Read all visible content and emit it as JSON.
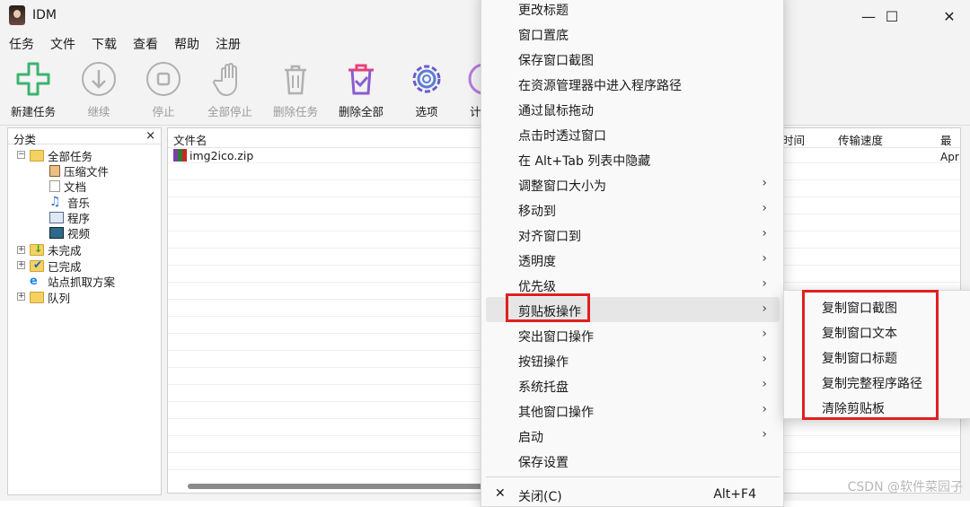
{
  "window": {
    "title": "IDM",
    "minimize": "—",
    "maximize": "☐",
    "close": "✕"
  },
  "menubar": [
    "任务",
    "文件",
    "下载",
    "查看",
    "帮助",
    "注册"
  ],
  "toolbar": [
    {
      "label": "新建任务",
      "icon": "add-task-icon",
      "enabled": true
    },
    {
      "label": "继续",
      "icon": "resume-icon",
      "enabled": false
    },
    {
      "label": "停止",
      "icon": "stop-icon",
      "enabled": false
    },
    {
      "label": "全部停止",
      "icon": "stop-all-icon",
      "enabled": false
    },
    {
      "label": "删除任务",
      "icon": "delete-task-icon",
      "enabled": false
    },
    {
      "label": "删除全部",
      "icon": "delete-all-icon",
      "enabled": true
    },
    {
      "label": "选项",
      "icon": "gear-icon",
      "enabled": true
    },
    {
      "label": "计",
      "icon": "scheduler-icon",
      "enabled": true
    }
  ],
  "sidebar": {
    "title": "分类",
    "close": "×",
    "tree": [
      {
        "label": "全部任务",
        "icon": "folder-icon",
        "expand": "−"
      },
      {
        "label": "压缩文件",
        "icon": "archive-icon"
      },
      {
        "label": "文档",
        "icon": "document-icon"
      },
      {
        "label": "音乐",
        "icon": "music-icon"
      },
      {
        "label": "程序",
        "icon": "program-icon"
      },
      {
        "label": "视频",
        "icon": "video-icon"
      },
      {
        "label": "未完成",
        "icon": "unfinished-folder-icon",
        "expand": "+"
      },
      {
        "label": "已完成",
        "icon": "finished-folder-icon",
        "expand": "+"
      },
      {
        "label": "站点抓取方案",
        "icon": "site-grabber-icon"
      },
      {
        "label": "队列",
        "icon": "queue-folder-icon",
        "expand": "+"
      }
    ]
  },
  "list": {
    "headers": {
      "filename": "文件名",
      "time": "时间",
      "speed": "传输速度",
      "last": "最后"
    },
    "rows": [
      {
        "filename": "img2ico.zip",
        "last": "Apr"
      }
    ]
  },
  "context_menu": {
    "items": [
      {
        "label": "更改标题",
        "submenu": false
      },
      {
        "label": "窗口置底",
        "submenu": false
      },
      {
        "label": "保存窗口截图",
        "submenu": false
      },
      {
        "label": "在资源管理器中进入程序路径",
        "submenu": false
      },
      {
        "label": "通过鼠标拖动",
        "submenu": false
      },
      {
        "label": "点击时透过窗口",
        "submenu": false
      },
      {
        "label": "在 Alt+Tab 列表中隐藏",
        "submenu": false
      },
      {
        "label": "调整窗口大小为",
        "submenu": true
      },
      {
        "label": "移动到",
        "submenu": true
      },
      {
        "label": "对齐窗口到",
        "submenu": true
      },
      {
        "label": "透明度",
        "submenu": true
      },
      {
        "label": "优先级",
        "submenu": true
      },
      {
        "label": "剪贴板操作",
        "submenu": true,
        "highlighted": true
      },
      {
        "label": "突出窗口操作",
        "submenu": true
      },
      {
        "label": "按钮操作",
        "submenu": true
      },
      {
        "label": "系统托盘",
        "submenu": true
      },
      {
        "label": "其他窗口操作",
        "submenu": true
      },
      {
        "label": "启动",
        "submenu": true
      },
      {
        "label": "保存设置",
        "submenu": false
      }
    ],
    "close_item": {
      "label": "关闭(C)",
      "shortcut": "Alt+F4",
      "icon": "close-icon"
    }
  },
  "clipboard_submenu": [
    "复制窗口截图",
    "复制窗口文本",
    "复制窗口标题",
    "复制完整程序路径",
    "清除剪贴板"
  ],
  "watermark": "CSDN @软件菜园子",
  "colors": {
    "highlight_border": "#e02020",
    "accent": "#3cb371",
    "idm_green": "#4caf50"
  }
}
